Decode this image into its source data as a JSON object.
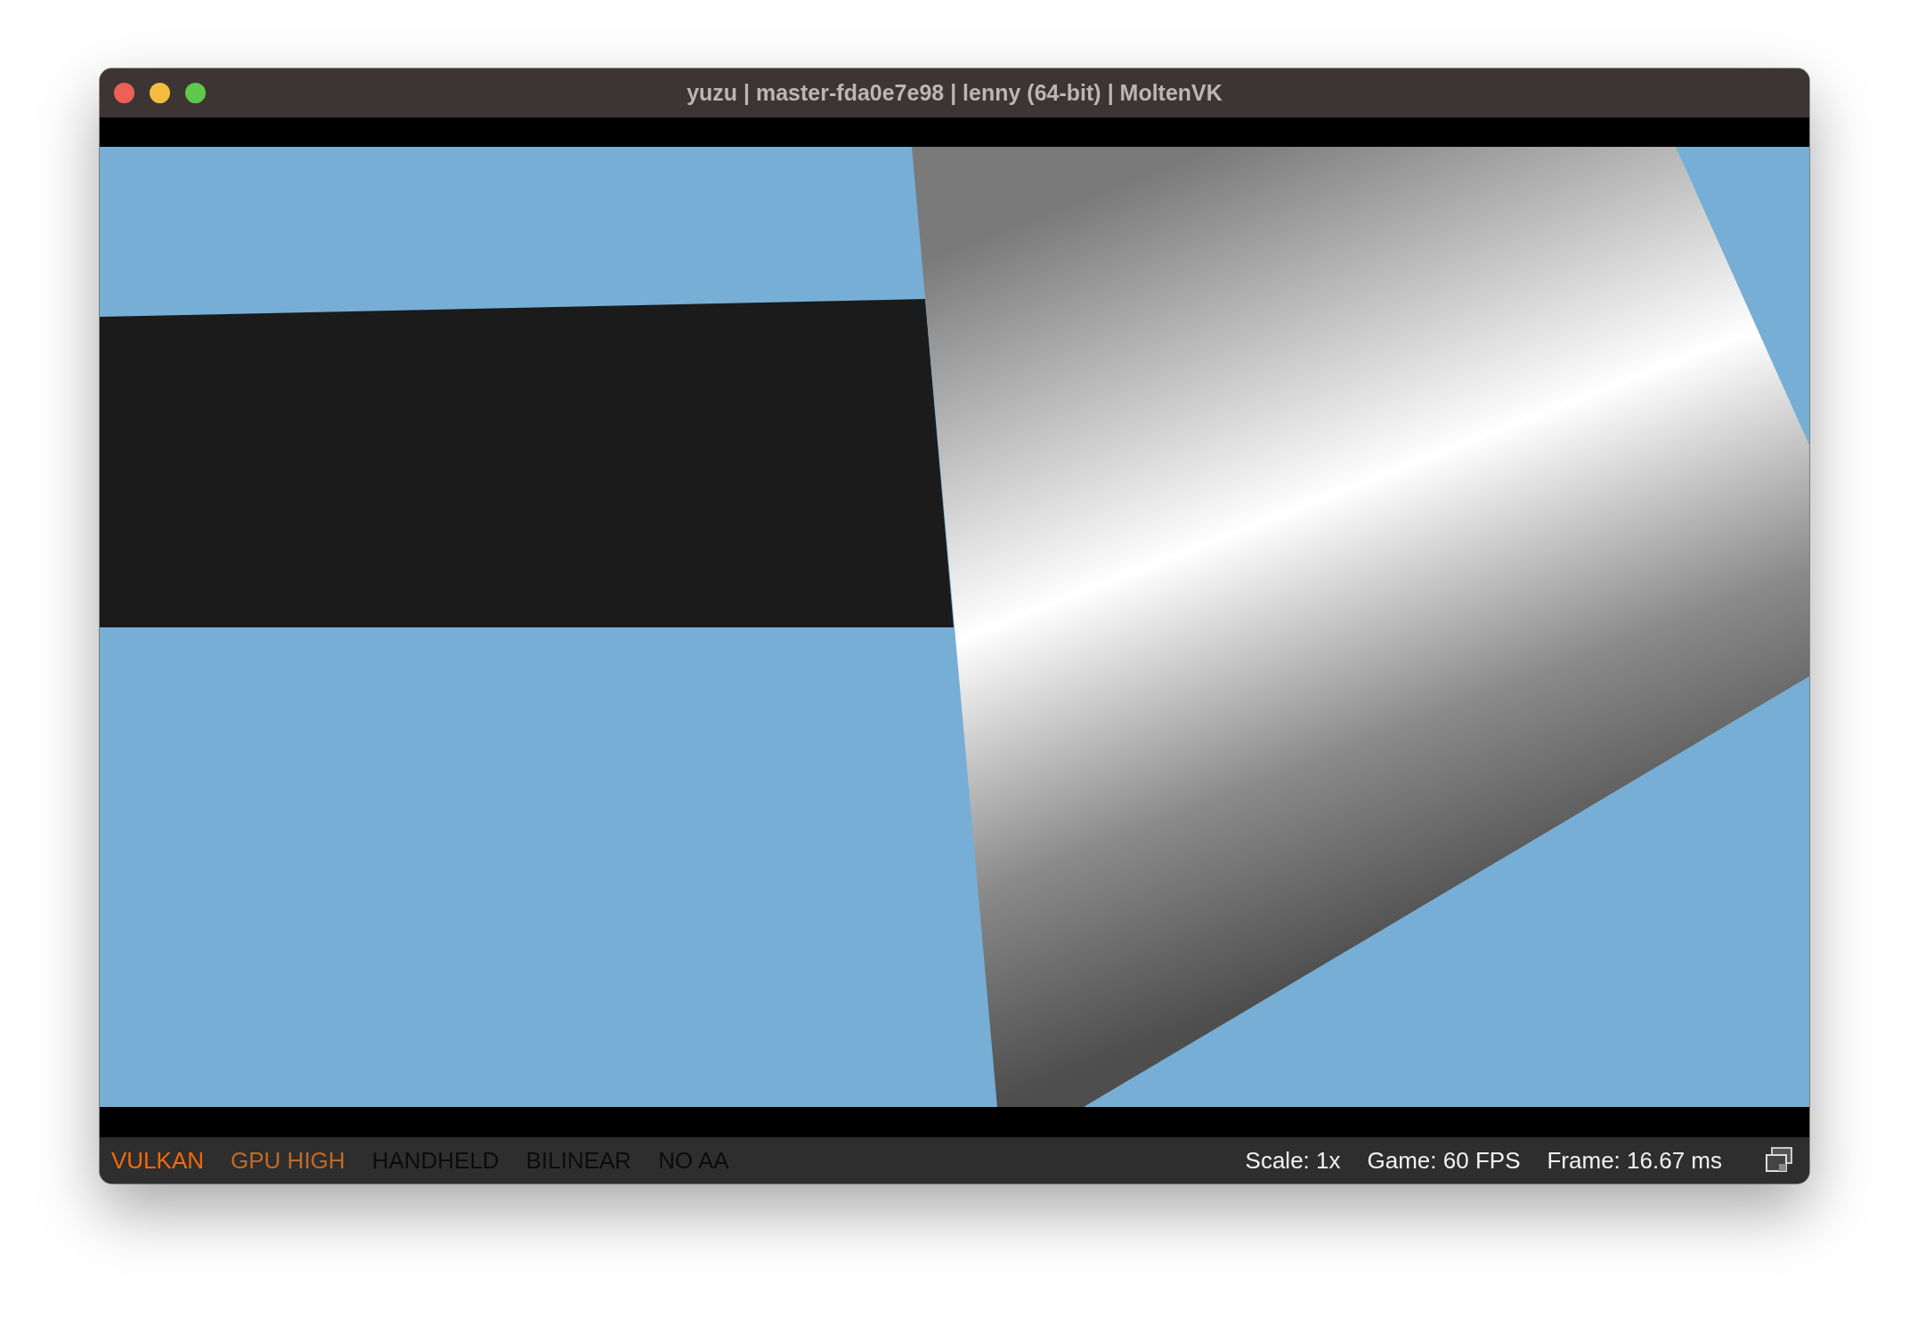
{
  "window": {
    "title": "yuzu | master-fda0e7e98 | lenny (64-bit) | MoltenVK"
  },
  "status_bar": {
    "left": [
      {
        "label": "VULKAN",
        "color": "#f26a0c"
      },
      {
        "label": "GPU HIGH",
        "color": "#c06a28"
      },
      {
        "label": "HANDHELD",
        "color": "#0c0c0c"
      },
      {
        "label": "BILINEAR",
        "color": "#0c0c0c"
      },
      {
        "label": "NO AA",
        "color": "#0c0c0c"
      }
    ],
    "right": [
      "Scale: 1x",
      "Game: 60 FPS",
      "Frame: 16.67 ms"
    ]
  }
}
